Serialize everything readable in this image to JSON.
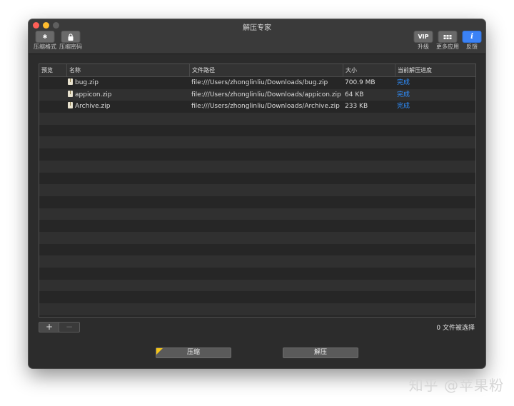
{
  "window": {
    "title": "解压专家"
  },
  "toolbar": {
    "left": [
      {
        "id": "format",
        "label": "压缩格式",
        "icon": "gear-icon",
        "glyph": "✱"
      },
      {
        "id": "password",
        "label": "压缩密码",
        "icon": "lock-icon",
        "glyph": "🔒"
      }
    ],
    "right": [
      {
        "id": "upgrade",
        "label": "升级",
        "icon": "vip-icon",
        "glyph": "VIP"
      },
      {
        "id": "more-apps",
        "label": "更多应用",
        "icon": "grid-icon",
        "glyph": "▪▪▪"
      },
      {
        "id": "feedback",
        "label": "反馈",
        "icon": "info-icon",
        "glyph": "i"
      }
    ]
  },
  "table": {
    "columns": [
      "预览",
      "名称",
      "文件路径",
      "大小",
      "当前解压进度"
    ],
    "rows": [
      {
        "name": "bug.zip",
        "path": "file:///Users/zhonglinliu/Downloads/bug.zip",
        "size": "700.9 MB",
        "progress": "完成"
      },
      {
        "name": "appicon.zip",
        "path": "file:///Users/zhonglinliu/Downloads/appicon.zip",
        "size": "64 KB",
        "progress": "完成"
      },
      {
        "name": "Archive.zip",
        "path": "file:///Users/zhonglinliu/Downloads/Archive.zip",
        "size": "233 KB",
        "progress": "完成"
      }
    ]
  },
  "footer": {
    "add_label": "+",
    "remove_label": "−",
    "selected_text": "0 文件被选择",
    "compress_label": "压缩",
    "extract_label": "解压"
  },
  "watermark": "知乎 @苹果粉",
  "colors": {
    "accent": "#2f8fff",
    "window_bg": "#2c2c2c",
    "badge": "#f5c518"
  }
}
